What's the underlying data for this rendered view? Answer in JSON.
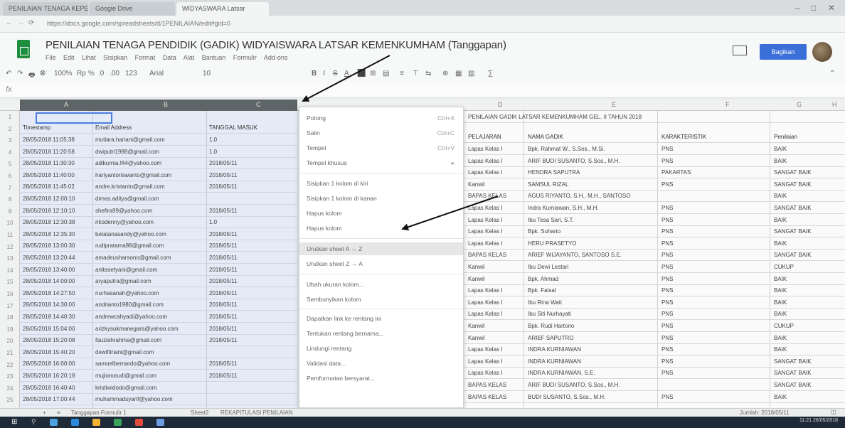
{
  "browser": {
    "tabs": [
      "PENILAIAN TENAGA KEPENDIDIKAN",
      "Google Drive",
      "WIDYASWARA Latsar"
    ],
    "url": "https://docs.google.com/spreadsheets/d/1PENILAIAN/edit#gid=0",
    "window_controls": [
      "–",
      "□",
      "✕"
    ]
  },
  "app": {
    "title": "PENILAIAN TENAGA PENDIDIK (GADIK) WIDYAISWARA LATSAR KEMENKUMHAM (Tanggapan)",
    "menus": [
      "File",
      "Edit",
      "Lihat",
      "Sisipkan",
      "Format",
      "Data",
      "Alat",
      "Bantuan",
      "Formulir",
      "Add-ons"
    ],
    "share_label": "Bagikan",
    "accent": "#3a6fd8",
    "logo_color": "#1e8e3e"
  },
  "toolbar": {
    "left_items": [
      "↶",
      "↷",
      "🖶",
      "⮿",
      "100%",
      "Rp",
      "%",
      ".0",
      ".00",
      "123",
      "Arial"
    ],
    "font_size": "10",
    "format_items": [
      "B",
      "I",
      "S",
      "A",
      "⬛",
      "⊞",
      "▤",
      "≡",
      "⊤",
      "⇆",
      "⊕",
      "▦",
      "▥",
      "∑"
    ]
  },
  "formula": {
    "fx": "fx",
    "value": ""
  },
  "columns": [
    "A",
    "B",
    "C",
    "D",
    "E",
    "F",
    "G",
    "H"
  ],
  "row_numbers": [
    "1",
    "2",
    "3",
    "4",
    "5",
    "6",
    "7",
    "8",
    "9",
    "10",
    "11",
    "12",
    "13",
    "14",
    "15",
    "16",
    "17",
    "18",
    "19",
    "20",
    "21",
    "22",
    "23",
    "24",
    "25"
  ],
  "left_table": {
    "headers": [
      "Timestamp",
      "Email Address",
      "TANGGAL MASUK"
    ],
    "rows": [
      [
        "28/05/2018 11:05:38",
        "mutiara.hariani@gmail.com",
        "1.0"
      ],
      [
        "28/05/2018 11:20:58",
        "dwiputri1988@gmail.com",
        "1.0"
      ],
      [
        "28/05/2018 11:30:30",
        "adikurnia.f44@yahoo.com",
        "2018/05/11"
      ],
      [
        "28/05/2018 11:40:00",
        "hariyantoriswanto@gmail.com",
        "2018/05/11"
      ],
      [
        "28/05/2018 11:45:02",
        "andre.kristanto@gmail.com",
        "2018/05/11"
      ],
      [
        "28/05/2018 12:00:10",
        "dimas.aditya@gmail.com",
        ""
      ],
      [
        "28/05/2018 12:10:10",
        "shefira99@yahoo.com",
        "2018/05/11"
      ],
      [
        "28/05/2018 12:30:38",
        "rikodenny@yahoo.com",
        "1.0"
      ],
      [
        "28/05/2018 12:35:30",
        "betatanasandy@yahoo.com",
        "2018/05/11"
      ],
      [
        "28/05/2018 13:00:30",
        "rudipratama88@gmail.com",
        "2018/05/11"
      ],
      [
        "28/05/2018 13:20:44",
        "amadeusharsono@gmail.com",
        "2018/05/11"
      ],
      [
        "28/05/2018 13:40:00",
        "anitasetyani@gmail.com",
        "2018/05/11"
      ],
      [
        "28/05/2018 14:00:00",
        "aryaputra@gmail.com",
        "2018/05/11"
      ],
      [
        "28/05/2018 14:27:50",
        "nurhasanah@yahoo.com",
        "2018/05/11"
      ],
      [
        "28/05/2018 14:30:00",
        "andrianto1980@gmail.com",
        "2018/05/11"
      ],
      [
        "28/05/2018 14:40:30",
        "andrewcahyadi@yahoo.com",
        "2018/05/11"
      ],
      [
        "28/05/2018 15:04:00",
        "arizkysukmanegara@yahoo.com",
        "2018/05/11"
      ],
      [
        "28/05/2018 15:20:08",
        "fauziahrahma@gmail.com",
        "2018/05/11"
      ],
      [
        "28/05/2018 15:40:20",
        "dewifitriani@gmail.com",
        ""
      ],
      [
        "28/05/2018 16:00:00",
        "samuelbernardo@yahoo.com",
        "2018/05/11"
      ],
      [
        "28/05/2018 16:20:18",
        "mujionorudi@gmail.com",
        "2018/05/11"
      ],
      [
        "28/05/2018 16:40:40",
        "kristiwidodo@gmail.com",
        ""
      ],
      [
        "28/05/2018 17:00:44",
        "muhammadsyarif@yahoo.com",
        ""
      ]
    ]
  },
  "right_table": {
    "banner": "PENILAIAN GADIK LATSAR KEMENKUMHAM GEL. II TAHUN 2018",
    "headers": [
      "PELAJARAN",
      "NAMA GADIK",
      "KARAKTERISTIK",
      "Penilaian"
    ],
    "rows": [
      [
        "Lapas Kelas I",
        "Bpk. Rahmat W., S.Sos., M.Si.",
        "PNS",
        "BAIK"
      ],
      [
        "Lapas Kelas I",
        "ARIF BUDI SUSANTO, S.Sos., M.H.",
        "PNS",
        "BAIK"
      ],
      [
        "Lapas Kelas I",
        "HENDRA SAPUTRA",
        "PAKARTAS",
        "SANGAT BAIK"
      ],
      [
        "Kanwil",
        "SAMSUL RIZAL",
        "PNS",
        "SANGAT BAIK"
      ],
      [
        "BAPAS KELAS",
        "AGUS RIYANTO, S.H., M.H., SANTOSO",
        "",
        "BAIK"
      ],
      [
        "Lapas Kelas I",
        "Indra Kurniawan, S.H., M.H.",
        "PNS",
        "SANGAT BAIK"
      ],
      [
        "Lapas Kelas I",
        "Ibu Tesa Sari, S.T.",
        "PNS",
        "BAIK"
      ],
      [
        "Lapas Kelas I",
        "Bpk. Suharto",
        "PNS",
        "SANGAT BAIK"
      ],
      [
        "Lapas Kelas I",
        "HERU PRASETYO",
        "PNS",
        "BAIK"
      ],
      [
        "BAPAS KELAS",
        "ARIEF WIJAYANTO, SANTOSO S.E.",
        "PNS",
        "SANGAT BAIK"
      ],
      [
        "Kanwil",
        "Ibu Dewi Lestari",
        "PNS",
        "CUKUP"
      ],
      [
        "Kanwil",
        "Bpk. Ahmad",
        "PNS",
        "BAIK"
      ],
      [
        "Lapas Kelas I",
        "Bpk. Faisal",
        "PNS",
        "BAIK"
      ],
      [
        "Lapas Kelas I",
        "Ibu Rina Wati",
        "PNS",
        "BAIK"
      ],
      [
        "Lapas Kelas I",
        "Ibu Siti Nurhayati",
        "PNS",
        "BAIK"
      ],
      [
        "Kanwil",
        "Bpk. Rudi Hartono",
        "PNS",
        "CUKUP"
      ],
      [
        "Kanwil",
        "ARIEF SAPUTRO",
        "PNS",
        "BAIK"
      ],
      [
        "Lapas Kelas I",
        "INDRA KURNIAWAN",
        "PNS",
        "BAIK"
      ],
      [
        "Lapas Kelas I",
        "INDRA KURNIAWAN",
        "PNS",
        "SANGAT BAIK"
      ],
      [
        "Lapas Kelas I",
        "INDRA KURNIAWAN, S.E.",
        "PNS",
        "SANGAT BAIK"
      ],
      [
        "BAPAS KELAS",
        "ARIF BUDI SUSANTO, S.Sos., M.H.",
        "",
        "SANGAT BAIK"
      ],
      [
        "BAPAS KELAS",
        "BUDI SUSANTO, S.Sos., M.H.",
        "PNS",
        "BAIK"
      ]
    ]
  },
  "context_menu": {
    "items": [
      {
        "label": "Potong",
        "shortcut": "Ctrl+X"
      },
      {
        "label": "Salin",
        "shortcut": "Ctrl+C"
      },
      {
        "label": "Tempel",
        "shortcut": "Ctrl+V"
      },
      {
        "label": "Tempel khusus",
        "shortcut": "▸"
      },
      {
        "label": "Sisipkan 1 kolom di kiri",
        "shortcut": ""
      },
      {
        "label": "Sisipkan 1 kolom di kanan",
        "shortcut": ""
      },
      {
        "label": "Hapus kolom",
        "shortcut": ""
      },
      {
        "label": "Hapus kolom",
        "shortcut": ""
      },
      {
        "label": "Urutkan sheet A → Z",
        "shortcut": ""
      },
      {
        "label": "Urutkan sheet Z → A",
        "shortcut": ""
      },
      {
        "label": "Ubah ukuran kolom...",
        "shortcut": ""
      },
      {
        "label": "Sembunyikan kolom",
        "shortcut": ""
      },
      {
        "label": "Dapatkan link ke rentang ini",
        "shortcut": ""
      },
      {
        "label": "Tentukan rentang bernama...",
        "shortcut": ""
      },
      {
        "label": "Lindungi rentang",
        "shortcut": ""
      },
      {
        "label": "Validasi data...",
        "shortcut": ""
      },
      {
        "label": "Pemformatan bersyarat...",
        "shortcut": ""
      }
    ],
    "highlighted_index": 8
  },
  "sheet_tabs": [
    "Tanggapan Formulir 1",
    "Sheet2",
    "REKAPITULASI PENILAIAN"
  ],
  "sheet_footer": "Jumlah: 2018/05/11",
  "taskbar": {
    "clock": "11:21 28/05/2018",
    "colors": [
      "#4aa3df",
      "#2d8bdd",
      "#f2b233",
      "#3aa35a",
      "#e24d3d",
      "#6b9de0"
    ]
  }
}
